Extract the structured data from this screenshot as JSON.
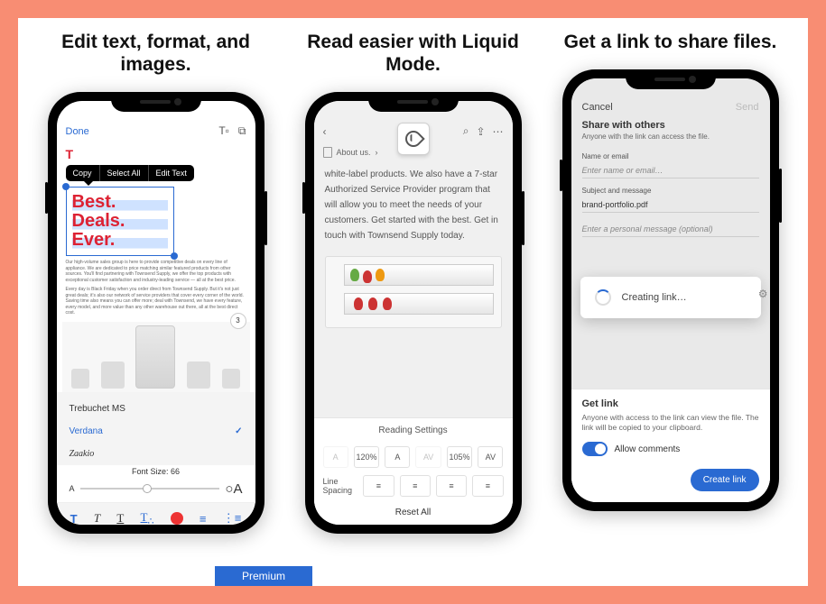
{
  "headlines": {
    "edit": "Edit text, format, and images.",
    "liquid": "Read easier with Liquid Mode.",
    "share": "Get a link to share files."
  },
  "screen1": {
    "done": "Done",
    "context": {
      "copy": "Copy",
      "select_all": "Select All",
      "edit_text": "Edit Text"
    },
    "hero": {
      "l1": "Best.",
      "l2": "Deals.",
      "l3": "Ever."
    },
    "page_num": "3",
    "fonts": {
      "trebuchet": "Trebuchet MS",
      "verdana": "Verdana",
      "script": "Zaakio"
    },
    "font_size_label": "Font Size: 66",
    "slider_small": "A",
    "slider_big": "A",
    "fmt": {
      "bold": "T",
      "italic": "T",
      "under": "T",
      "color": "T"
    }
  },
  "screen2": {
    "crumb": "About us.",
    "body": "white-label products. We also have a 7-star Authorized Service Provider program that will allow you to meet the needs of your customers. Get started with the best. Get in touch with Townsend Supply today.",
    "sheet_title": "Reading Settings",
    "text_row": {
      "a": "A",
      "pct1": "120%",
      "bigA": "A",
      "av": "AV",
      "pct2": "105%",
      "av2": "AV"
    },
    "line_spacing": "Line Spacing",
    "reset": "Reset All"
  },
  "screen3": {
    "cancel": "Cancel",
    "send": "Send",
    "title": "Share with others",
    "subtitle": "Anyone with the link can access the file.",
    "name_label": "Name or email",
    "name_placeholder": "Enter name or email…",
    "subj_label": "Subject and message",
    "subj_value": "brand-portfolio.pdf",
    "msg_placeholder": "Enter a personal message (optional)",
    "toast": "Creating link…",
    "getlink": "Get link",
    "getlink_desc": "Anyone with access to the link can view the file. The link will be copied to your clipboard.",
    "allow": "Allow comments",
    "create": "Create link"
  },
  "premium": "Premium"
}
